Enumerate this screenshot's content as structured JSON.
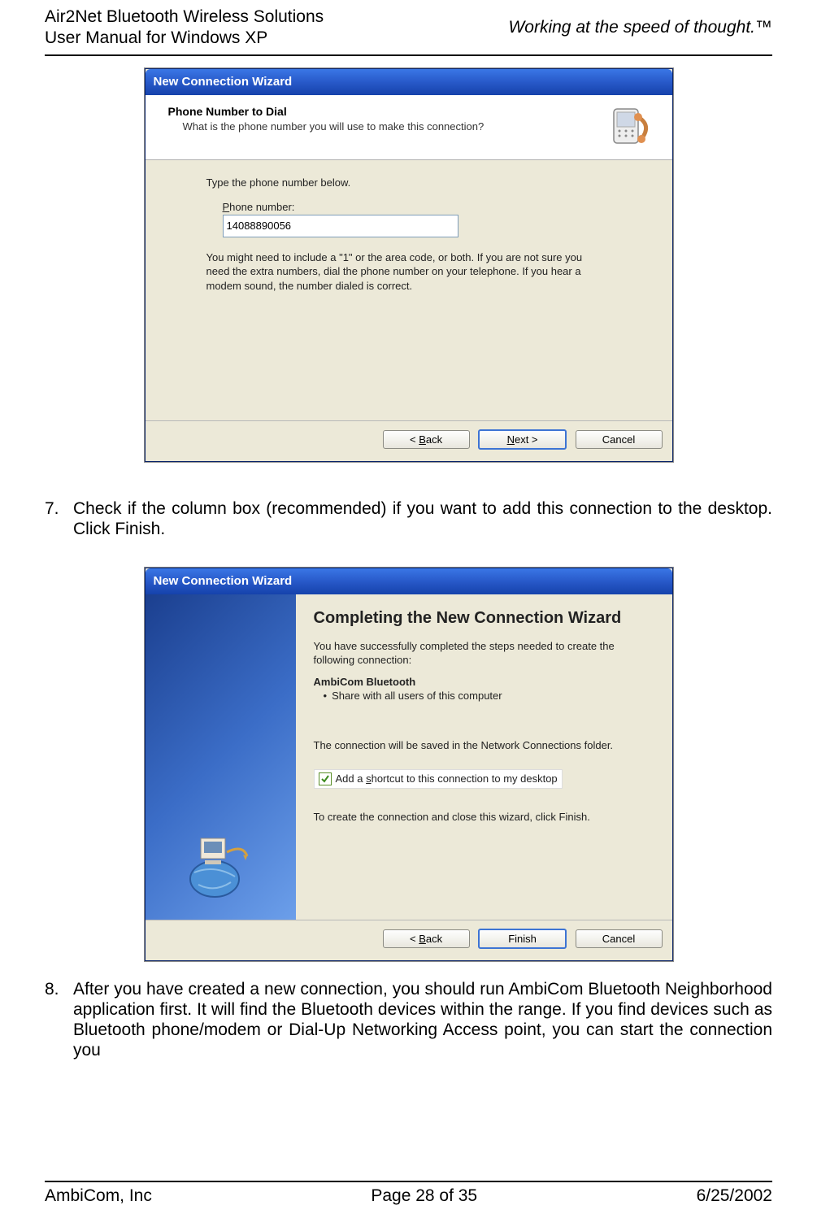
{
  "header": {
    "line1": "Air2Net Bluetooth Wireless Solutions",
    "line2": "User Manual for Windows XP",
    "tagline": "Working at the speed of thought.™"
  },
  "dialog1": {
    "title": "New Connection Wizard",
    "heading": "Phone Number to Dial",
    "subheading": "What is the phone number you will use to make this connection?",
    "body_label": "Type the phone number below.",
    "field_label_pre": "P",
    "field_label_post": "hone number:",
    "phone_value": "14088890056",
    "hint": "You might need to include a \"1\" or the area code, or both. If you are not sure you need the extra numbers, dial the phone number on your telephone. If you hear a modem sound, the number dialed is correct.",
    "back_pre": "< ",
    "back_u": "B",
    "back_post": "ack",
    "next_u": "N",
    "next_post": "ext >",
    "cancel": "Cancel"
  },
  "step7": {
    "num": "7.",
    "text": "Check if the column box (recommended) if you want to add this connection to the desktop. Click Finish."
  },
  "dialog2": {
    "title": "New Connection Wizard",
    "big_title": "Completing the New Connection Wizard",
    "para1": "You have successfully completed the steps needed to create the following connection:",
    "conn_name": "AmbiCom Bluetooth",
    "bullet": "Share with all users of this computer",
    "para2": "The connection will be saved in the Network Connections folder.",
    "checkbox_pre": "Add a ",
    "checkbox_u": "s",
    "checkbox_post": "hortcut to this connection to my desktop",
    "para3": "To create the connection and close this wizard, click Finish.",
    "back_pre": "< ",
    "back_u": "B",
    "back_post": "ack",
    "finish": "Finish",
    "cancel": "Cancel"
  },
  "step8": {
    "num": "8.",
    "text": "After you have created a new connection, you should run AmbiCom Bluetooth Neighborhood application first. It will find the Bluetooth devices within the range. If you find devices such as Bluetooth phone/modem or Dial-Up Networking Access point, you can start the connection you"
  },
  "footer": {
    "left": "AmbiCom, Inc",
    "center": "Page 28 of 35",
    "right": "6/25/2002"
  }
}
